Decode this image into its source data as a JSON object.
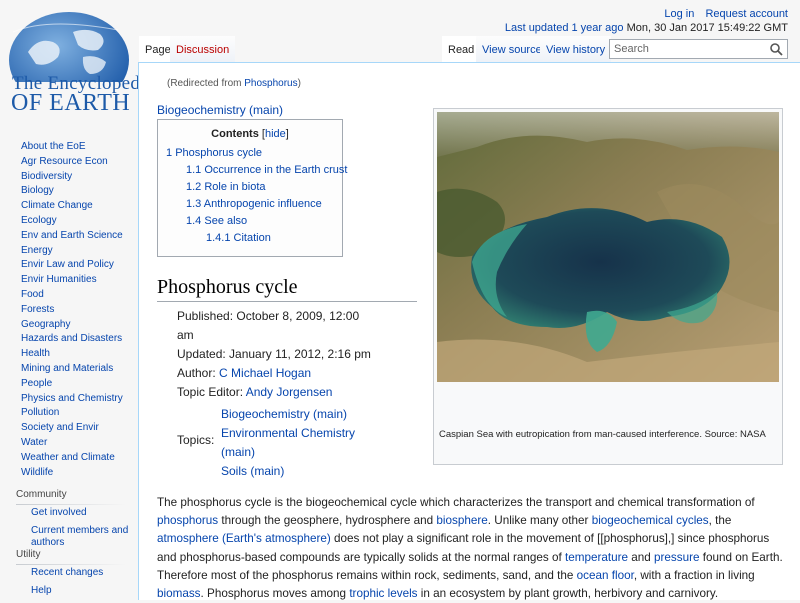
{
  "logo": {
    "line1": "The Encyclopedia",
    "line2": "OF EARTH"
  },
  "personal": {
    "login": "Log in",
    "request_account": "Request account",
    "last_updated_link": "Last updated 1 year ago",
    "timestamp": "Mon, 30 Jan 2017 15:49:22 GMT"
  },
  "tabs": {
    "page": "Page",
    "discussion": "Discussion",
    "read": "Read",
    "view_source": "View source",
    "view_history": "View history"
  },
  "search": {
    "placeholder": "Search",
    "value": ""
  },
  "sidebar": {
    "nav": [
      "About the EoE",
      "Agr Resource Econ",
      "Biodiversity",
      "Biology",
      "Climate Change",
      "Ecology",
      "Env and Earth Science",
      "Energy",
      "Envir Law and Policy",
      "Envir Humanities",
      "Food",
      "Forests",
      "Geography",
      "Hazards and Disasters",
      "Health",
      "Mining and Materials",
      "People",
      "Physics and Chemistry",
      "Pollution",
      "Society and Envir",
      "Water",
      "Weather and Climate",
      "Wildlife"
    ],
    "community_title": "Community",
    "community": [
      "Get involved",
      "Current members and authors"
    ],
    "utility_title": "Utility",
    "utility": [
      "Recent changes",
      "Help"
    ]
  },
  "content": {
    "redirect": "(Redirected from Phosphorus)",
    "redirect_prefix": "(Redirected from ",
    "redirect_link": "Phosphorus",
    "redirect_suffix": ")",
    "parent_link": "Biogeochemistry (main)",
    "toc": {
      "title": "Contents",
      "hide_open": "[",
      "hide": "hide",
      "hide_close": "]",
      "entries": [
        {
          "num": "1",
          "label": "Phosphorus cycle"
        },
        {
          "num": "1.1",
          "label": "Occurrence in the Earth crust"
        },
        {
          "num": "1.2",
          "label": "Role in biota"
        },
        {
          "num": "1.3",
          "label": "Anthropogenic influence"
        },
        {
          "num": "1.4",
          "label": "See also"
        },
        {
          "num": "1.4.1",
          "label": "Citation"
        }
      ]
    },
    "heading": "Phosphorus cycle",
    "meta": {
      "published": "Published: October 8, 2009, 12:00 am",
      "updated": "Updated: January 11, 2012, 2:16 pm",
      "author_label": "Author: ",
      "author": "C Michael Hogan",
      "topic_editor_label": "Topic Editor: ",
      "topic_editor": "Andy Jorgensen"
    },
    "topics_label": "Topics:",
    "topics": [
      "Biogeochemistry (main)",
      "Environmental Chemistry (main)",
      "Soils (main)"
    ],
    "figure_caption": "Caspian Sea with eutropication from man-caused interference. Source: NASA",
    "body": {
      "t1": "The phosphorus cycle is the biogeochemical cycle which characterizes the transport and chemical transformation of ",
      "l1": "phosphorus",
      "t2": " through the geosphere, hydrosphere and ",
      "l2": "biosphere",
      "t3": ". Unlike many other ",
      "l3": "biogeochemical cycles",
      "t4": ", the ",
      "l4": "atmosphere (Earth's atmosphere)",
      "t5": " does not play a significant role in the movement of [[phosphorus],] since phosphorus and phosphorus-based compounds are typically solids at the normal ranges of ",
      "l5": "temperature",
      "t6": " and ",
      "l6": "pressure",
      "t7": " found on Earth. Therefore most of the phosphorus remains within rock, sediments, sand, and the ",
      "l7": "ocean floor",
      "t8": ", with a fraction in living ",
      "l8": "biomass",
      "t9": ". Phosphorus moves among ",
      "l9": "trophic levels",
      "t10": " in an ecosystem by plant growth, herbivory and carnivory."
    }
  }
}
